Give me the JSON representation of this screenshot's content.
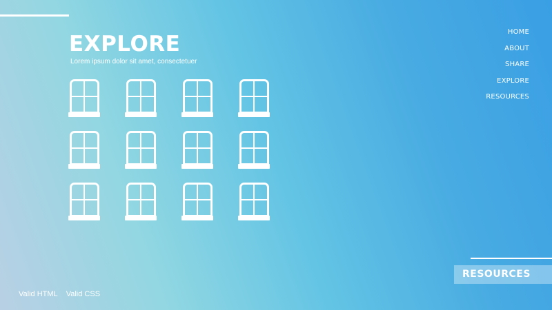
{
  "hero": {
    "title": "EXPLORE",
    "subtitle": "Lorem ipsum dolor sit amet, consectetuer"
  },
  "nav": {
    "items": [
      "HOME",
      "ABOUT",
      "SHARE",
      "EXPLORE",
      "RESOURCES"
    ]
  },
  "cta": {
    "label": "RESOURCES"
  },
  "footer": {
    "valid_html": "Valid HTML",
    "valid_css": "Valid CSS"
  },
  "gallery": {
    "rows": 3,
    "columns": 4,
    "icon": "window-icon"
  },
  "colors": {
    "gradient_start": "#b9d0e4",
    "gradient_mid": "#63c4e4",
    "gradient_end": "#3a9fe4",
    "foreground": "#ffffff"
  }
}
